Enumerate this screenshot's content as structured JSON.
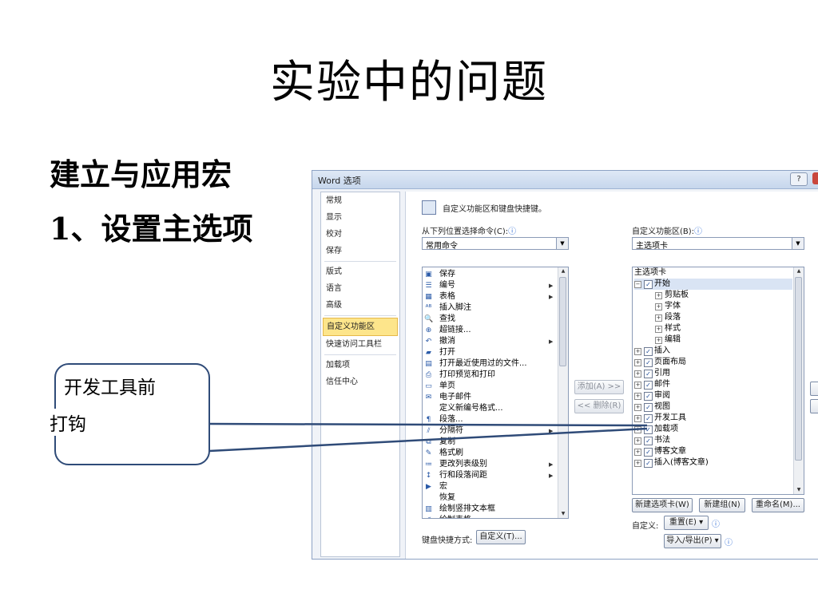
{
  "slide": {
    "title": "实验中的问题",
    "subtitle": "建立与应用宏",
    "step": "1、设置主选项",
    "callout_line1": "开发工具前",
    "callout_line2": "打钩"
  },
  "window": {
    "title": "Word 选项",
    "help_label": "?"
  },
  "nav": {
    "items": [
      "常规",
      "显示",
      "校对",
      "保存",
      "版式",
      "语言",
      "高级",
      "自定义功能区",
      "快速访问工具栏",
      "加载项",
      "信任中心"
    ],
    "active": "自定义功能区"
  },
  "content": {
    "header": "自定义功能区和键盘快捷键。",
    "from_label": "从下列位置选择命令(C):",
    "from_value": "常用命令",
    "ribbon_label": "自定义功能区(B):",
    "ribbon_value": "主选项卡",
    "commands": [
      {
        "icon": "save-icon",
        "glyph": "▣",
        "label": "保存"
      },
      {
        "icon": "numbering-icon",
        "glyph": "☰",
        "label": "编号"
      },
      {
        "icon": "table-icon",
        "glyph": "▦",
        "label": "表格"
      },
      {
        "icon": "footnote-icon",
        "glyph": "ᴬᴮ",
        "label": "插入脚注"
      },
      {
        "icon": "find-icon",
        "glyph": "🔍",
        "label": "查找"
      },
      {
        "icon": "hyperlink-icon",
        "glyph": "⊕",
        "label": "超链接..."
      },
      {
        "icon": "undo-icon",
        "glyph": "↶",
        "label": "撤消"
      },
      {
        "icon": "open-icon",
        "glyph": "▰",
        "label": "打开"
      },
      {
        "icon": "recent-files-icon",
        "glyph": "▤",
        "label": "打开最近使用过的文件..."
      },
      {
        "icon": "print-preview-icon",
        "glyph": "⎙",
        "label": "打印预览和打印"
      },
      {
        "icon": "single-page-icon",
        "glyph": "▭",
        "label": "单页"
      },
      {
        "icon": "email-icon",
        "glyph": "✉",
        "label": "电子邮件"
      },
      {
        "icon": "none",
        "glyph": "",
        "label": "定义新编号格式..."
      },
      {
        "icon": "paragraph-icon",
        "glyph": "¶",
        "label": "段落..."
      },
      {
        "icon": "separator-icon",
        "glyph": "⫽",
        "label": "分隔符"
      },
      {
        "icon": "copy-icon",
        "glyph": "⧉",
        "label": "复制"
      },
      {
        "icon": "format-painter-icon",
        "glyph": "✎",
        "label": "格式刷"
      },
      {
        "icon": "list-level-icon",
        "glyph": "≔",
        "label": "更改列表级别"
      },
      {
        "icon": "line-spacing-icon",
        "glyph": "↕",
        "label": "行和段落间距"
      },
      {
        "icon": "macro-icon",
        "glyph": "▶",
        "label": "宏"
      },
      {
        "icon": "none",
        "glyph": "",
        "label": "恢复"
      },
      {
        "icon": "vertical-textbox-icon",
        "glyph": "▥",
        "label": "绘制竖排文本框"
      },
      {
        "icon": "draw-table-icon",
        "glyph": "✐",
        "label": "绘制表格"
      }
    ],
    "tree_header": "主选项卡",
    "tree": [
      {
        "label": "开始",
        "toggle": "−",
        "checked": true,
        "level": 0
      },
      {
        "label": "剪贴板",
        "toggle": "+",
        "checked": false,
        "level": 1
      },
      {
        "label": "字体",
        "toggle": "+",
        "checked": false,
        "level": 1
      },
      {
        "label": "段落",
        "toggle": "+",
        "checked": false,
        "level": 1
      },
      {
        "label": "样式",
        "toggle": "+",
        "checked": false,
        "level": 1
      },
      {
        "label": "编辑",
        "toggle": "+",
        "checked": false,
        "level": 1
      },
      {
        "label": "插入",
        "toggle": "+",
        "checked": true,
        "level": 0
      },
      {
        "label": "页面布局",
        "toggle": "+",
        "checked": true,
        "level": 0
      },
      {
        "label": "引用",
        "toggle": "+",
        "checked": true,
        "level": 0
      },
      {
        "label": "邮件",
        "toggle": "+",
        "checked": true,
        "level": 0
      },
      {
        "label": "审阅",
        "toggle": "+",
        "checked": true,
        "level": 0
      },
      {
        "label": "视图",
        "toggle": "+",
        "checked": true,
        "level": 0
      },
      {
        "label": "开发工具",
        "toggle": "+",
        "checked": true,
        "level": 0
      },
      {
        "label": "加载项",
        "toggle": "+",
        "checked": true,
        "level": 0
      },
      {
        "label": "书法",
        "toggle": "+",
        "checked": true,
        "level": 0
      },
      {
        "label": "博客文章",
        "toggle": "+",
        "checked": true,
        "level": 0
      },
      {
        "label": "插入(博客文章)",
        "toggle": "+",
        "checked": true,
        "level": 0
      }
    ],
    "add_button": "添加(A) >>",
    "remove_button": "<< 删除(R)",
    "new_tab_button": "新建选项卡(W)",
    "new_group_button": "新建组(N)",
    "rename_button": "重命名(M)...",
    "customize_label": "自定义:",
    "reset_button": "重置(E) ▾",
    "import_export_button": "导入/导出(P) ▾",
    "keyboard_label": "键盘快捷方式:",
    "keyboard_button": "自定义(T)...",
    "checkmark": "✓",
    "info_glyph": "ⓘ"
  },
  "colors": {
    "callout_border": "#2f4b78",
    "nav_active_bg": "#fde58b",
    "window_border": "#8da2c4"
  }
}
